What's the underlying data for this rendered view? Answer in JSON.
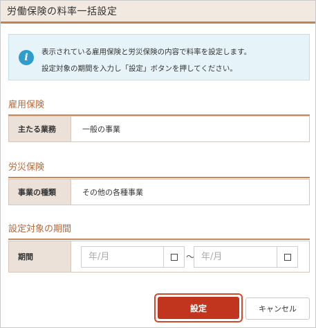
{
  "dialog": {
    "title": "労働保険の料率一括設定"
  },
  "info": {
    "icon": "info-icon",
    "line1": "表示されている雇用保険と労災保険の内容で料率を設定します。",
    "line2": "設定対象の期間を入力し「設定」ボタンを押してください。"
  },
  "employment": {
    "heading": "雇用保険",
    "label": "主たる業務",
    "value": "一般の事業"
  },
  "workers_comp": {
    "heading": "労災保険",
    "label": "事業の種類",
    "value": "その他の各種事業"
  },
  "period": {
    "heading": "設定対象の期間",
    "label": "期間",
    "from_placeholder": "年/月",
    "to_placeholder": "年/月",
    "separator": "～",
    "calendar_icon": "calendar-icon"
  },
  "buttons": {
    "submit": "設定",
    "cancel": "キャンセル"
  },
  "colors": {
    "accent": "#c0844f",
    "primary_button": "#c1341d",
    "info_bg": "#e6f3f8",
    "info_icon": "#2e9ccd"
  }
}
